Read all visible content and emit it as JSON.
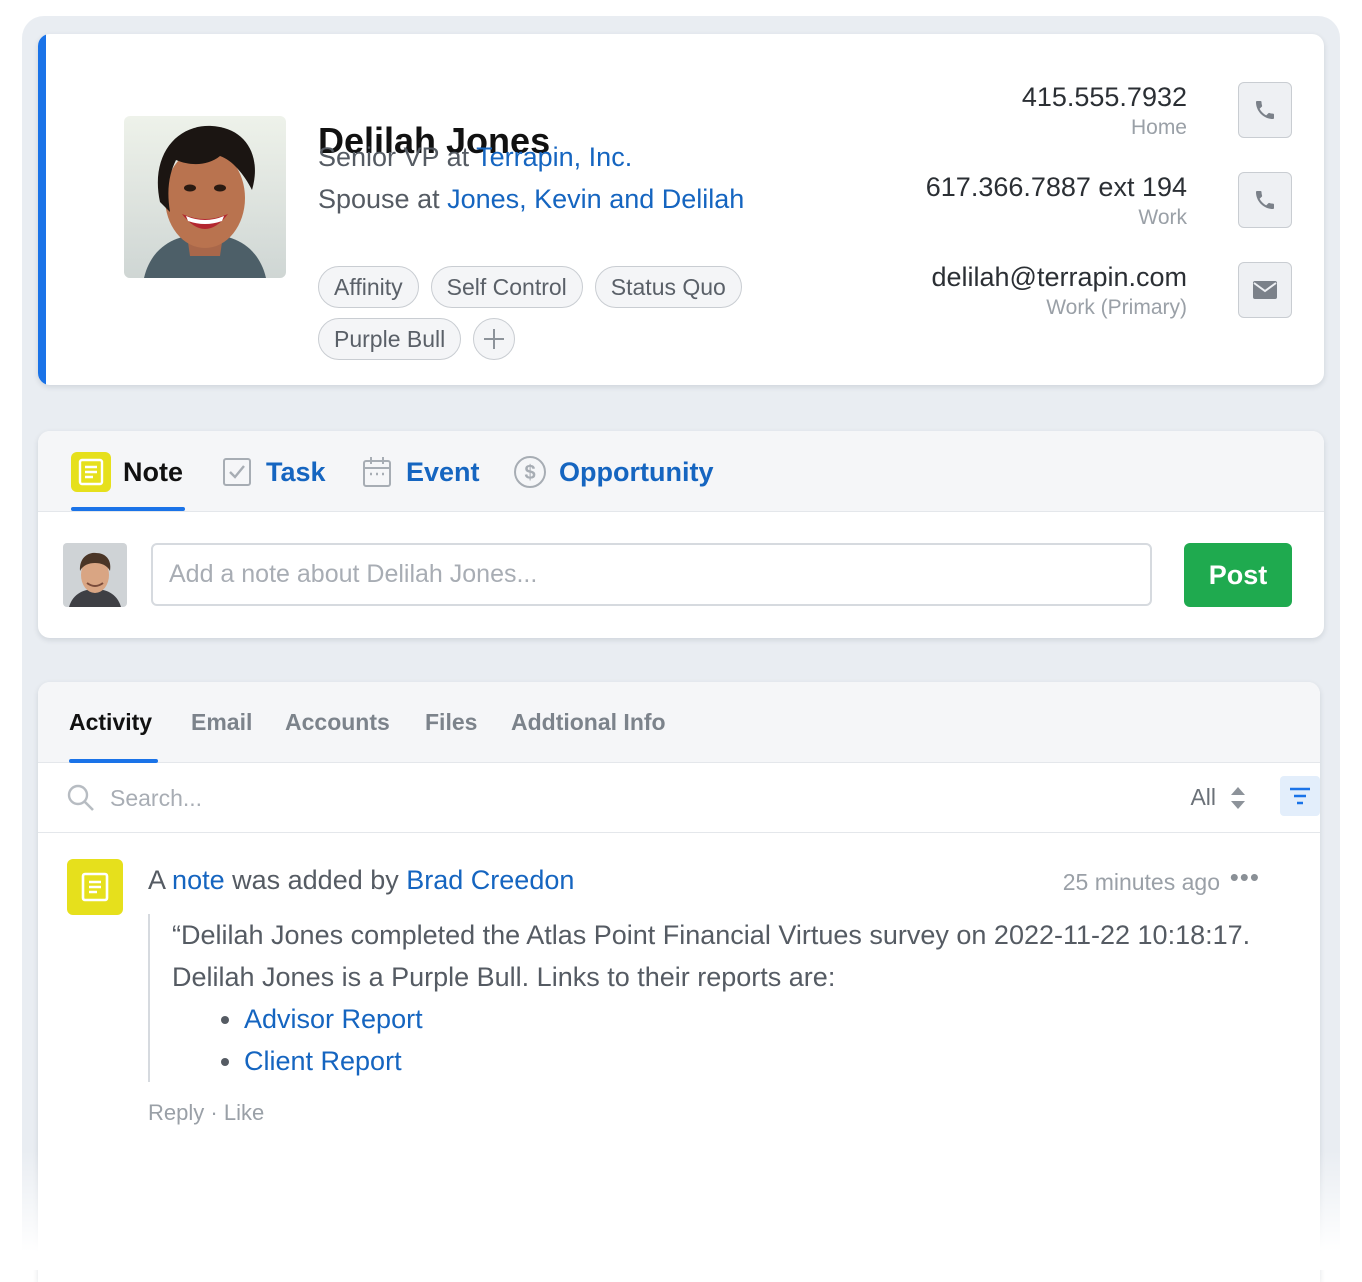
{
  "contact": {
    "name": "Delilah Jones",
    "role1_prefix": "Senior VP at",
    "role1_link": "Terrapin, Inc.",
    "role2_prefix": "Spouse at",
    "role2_link": "Jones, Kevin and Delilah",
    "tags": [
      "Affinity",
      "Self Control",
      "Status Quo",
      "Purple Bull"
    ],
    "phones": [
      {
        "value": "415.555.7932",
        "label": "Home",
        "icon": "phone-icon"
      },
      {
        "value": "617.366.7887 ext 194",
        "label": "Work",
        "icon": "phone-icon"
      }
    ],
    "email": {
      "value": "delilah@terrapin.com",
      "label": "Work (Primary)",
      "icon": "mail-icon"
    },
    "accent_color": "#1a73e8"
  },
  "composer": {
    "tabs": [
      {
        "label": "Note",
        "icon": "note-icon"
      },
      {
        "label": "Task",
        "icon": "checkbox-icon"
      },
      {
        "label": "Event",
        "icon": "calendar-icon"
      },
      {
        "label": "Opportunity",
        "icon": "dollar-icon"
      }
    ],
    "active_tab": "Note",
    "placeholder": "Add a note about Delilah Jones...",
    "post_label": "Post",
    "post_color": "#1faa4f"
  },
  "activity": {
    "tabs": [
      "Activity",
      "Email",
      "Accounts",
      "Files",
      "Addtional Info"
    ],
    "active_tab": "Activity",
    "search_placeholder": "Search...",
    "filter_value": "All",
    "feed": {
      "prefix": "A",
      "type_link": "note",
      "middle": "was added by",
      "author": "Brad Creedon",
      "time": "25 minutes ago",
      "more": "•••",
      "body": "“Delilah Jones completed the Atlas Point Financial Virtues survey on 2022-11-22 10:18:17. Delilah Jones is a Purple Bull. Links to their reports are:",
      "links": [
        "Advisor Report",
        "Client Report"
      ],
      "reply": "Reply",
      "separator": "·",
      "like": "Like"
    }
  }
}
